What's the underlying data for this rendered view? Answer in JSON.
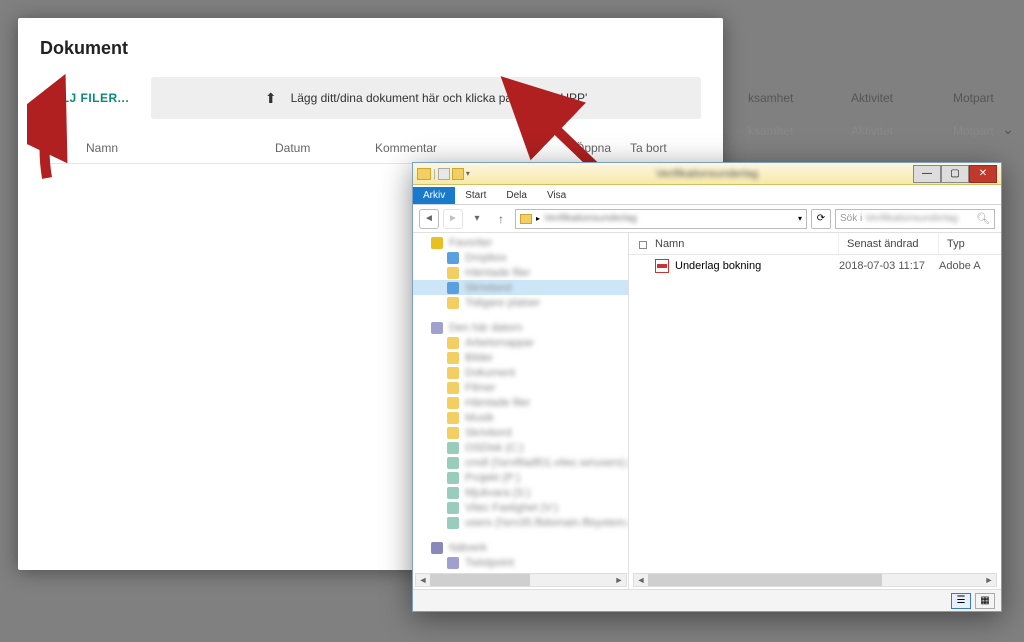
{
  "background": {
    "headers": [
      "ksamhet",
      "Aktivitet",
      "Motpart"
    ],
    "subheaders": [
      "ksamhet",
      "Aktivitet",
      "Motpart"
    ]
  },
  "modal": {
    "title": "Dokument",
    "choose_label": "VÄLJ FILER...",
    "dropzone_hint": "Lägg ditt/dina dokument här och klicka på 'LADDA UPP'",
    "columns": {
      "namn": "Namn",
      "datum": "Datum",
      "kommentar": "Kommentar",
      "oppna": "Öppna",
      "tabort": "Ta bort"
    }
  },
  "explorer": {
    "window_title": "Verifikationsunderlag",
    "tabs": {
      "arkiv": "Arkiv",
      "start": "Start",
      "dela": "Dela",
      "visa": "Visa"
    },
    "nav": {
      "path_blur": "Verifikationsunderlag",
      "search_prefix": "Sök i",
      "search_blur": "Verifikationsunderlag"
    },
    "tree": {
      "favorites": "Favoriter",
      "fav_items": [
        "Dropbox",
        "Hämtade filer",
        "Skrivbord",
        "Tidigare platser"
      ],
      "thispc": "Den här datorn",
      "pc_items": [
        "Arbetsmappar",
        "Bilder",
        "Dokument",
        "Filmer",
        "Hämtade filer",
        "Musik",
        "Skrivbord",
        "OSDisk (C:)",
        "cmdl (\\\\srvfiladf01.vitec.se\\users) (H:)",
        "Projekt (P:)",
        "Mjukvara (S:)",
        "Vitec Fastighet (V:)",
        "users (\\\\srv35.fltdomain.fltsystem.se) (Z:)"
      ],
      "network": "Nätverk",
      "net_item": "Twistpoint"
    },
    "list": {
      "columns": {
        "namn": "Namn",
        "andrad": "Senast ändrad",
        "typ": "Typ"
      },
      "rows": [
        {
          "name": "Underlag bokning",
          "modified": "2018-07-03 11:17",
          "type": "Adobe A"
        }
      ]
    }
  }
}
